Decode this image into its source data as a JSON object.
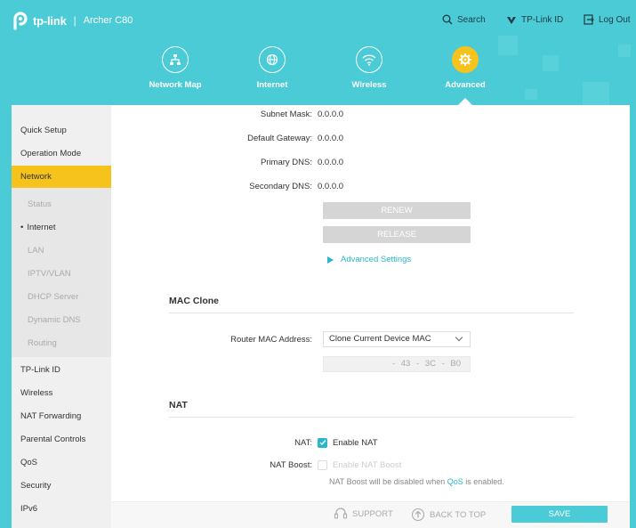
{
  "header": {
    "brand": "tp-link",
    "separator": "|",
    "model": "Archer C80",
    "links": {
      "search": "Search",
      "tplink_id": "TP-Link ID",
      "logout": "Log Out"
    },
    "nav": [
      {
        "label": "Network Map",
        "icon": "network-map-icon"
      },
      {
        "label": "Internet",
        "icon": "globe-icon"
      },
      {
        "label": "Wireless",
        "icon": "wifi-icon"
      },
      {
        "label": "Advanced",
        "icon": "gear-icon",
        "active": true
      }
    ]
  },
  "sidebar": {
    "items": {
      "quick_setup": "Quick Setup",
      "operation_mode": "Operation Mode",
      "network": "Network",
      "tplink_id": "TP-Link ID",
      "wireless": "Wireless",
      "nat_forwarding": "NAT Forwarding",
      "parental_controls": "Parental Controls",
      "qos": "QoS",
      "security": "Security",
      "ipv6": "IPv6"
    },
    "network_sub": {
      "status": "Status",
      "internet": "Internet",
      "lan": "LAN",
      "iptv": "IPTV/VLAN",
      "dhcp": "DHCP Server",
      "ddns": "Dynamic DNS",
      "routing": "Routing"
    }
  },
  "main": {
    "subnet_mask": {
      "label": "Subnet Mask:",
      "value": "0.0.0.0"
    },
    "default_gateway": {
      "label": "Default Gateway:",
      "value": "0.0.0.0"
    },
    "primary_dns": {
      "label": "Primary DNS:",
      "value": "0.0.0.0"
    },
    "secondary_dns": {
      "label": "Secondary DNS:",
      "value": "0.0.0.0"
    },
    "renew": "RENEW",
    "release": "RELEASE",
    "advanced_settings": "Advanced Settings",
    "mac_clone": {
      "title": "MAC Clone",
      "label": "Router MAC Address:",
      "select_value": "Clone Current Device MAC",
      "mac_value": "- 43 - 3C - B0"
    },
    "nat": {
      "title": "NAT",
      "nat_label": "NAT:",
      "nat_option": "Enable NAT",
      "boost_label": "NAT Boost:",
      "boost_option": "Enable NAT Boost",
      "note_prefix": "NAT Boost will be disabled when ",
      "note_link": "QoS",
      "note_suffix": " is enabled."
    }
  },
  "footer": {
    "support": "SUPPORT",
    "back_to_top": "BACK TO TOP",
    "save": "SAVE"
  },
  "colors": {
    "accent": "#4acbd6",
    "active": "#f6c21c",
    "link": "#2ab7c9"
  }
}
